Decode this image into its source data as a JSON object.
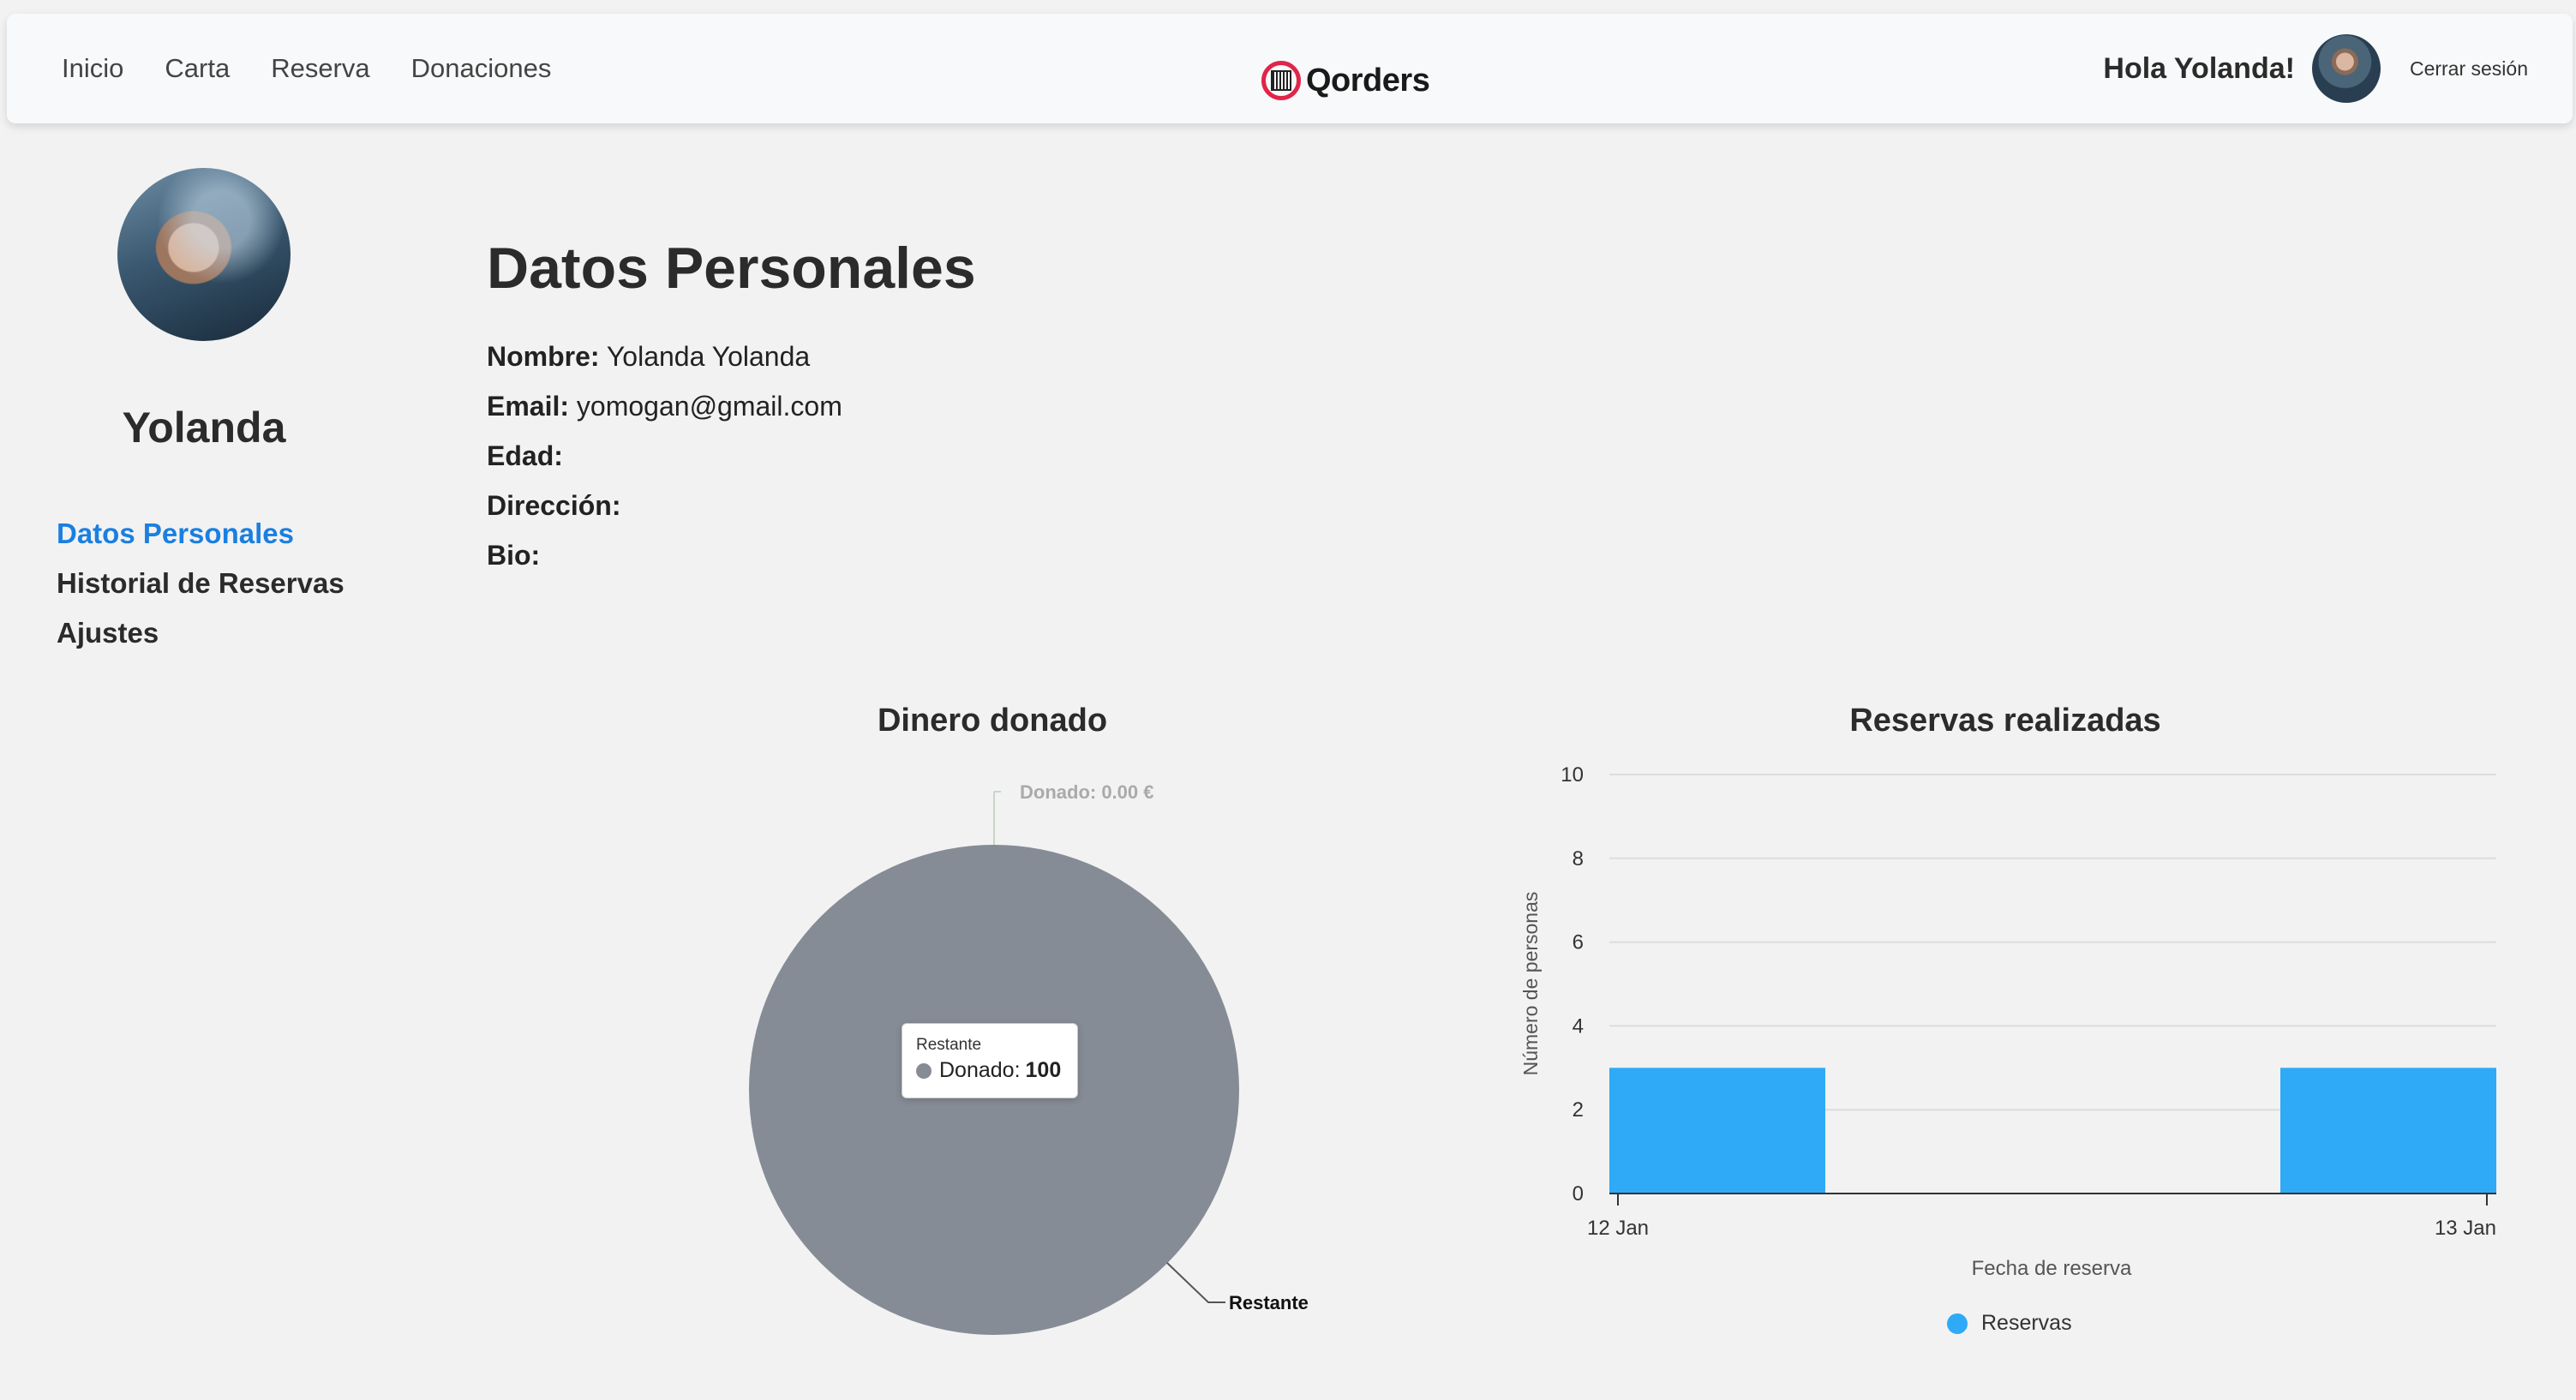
{
  "nav": {
    "links": [
      "Inicio",
      "Carta",
      "Reserva",
      "Donaciones"
    ],
    "brand": "Qorders",
    "greeting": "Hola Yolanda!",
    "logout": "Cerrar sesión"
  },
  "sidebar": {
    "name": "Yolanda",
    "items": [
      {
        "label": "Datos Personales",
        "active": true
      },
      {
        "label": "Historial de Reservas",
        "active": false
      },
      {
        "label": "Ajustes",
        "active": false
      }
    ]
  },
  "profile": {
    "title": "Datos Personales",
    "fields": [
      {
        "key": "Nombre:",
        "value": "Yolanda Yolanda"
      },
      {
        "key": "Email:",
        "value": "yomogan@gmail.com"
      },
      {
        "key": "Edad:",
        "value": ""
      },
      {
        "key": "Dirección:",
        "value": ""
      },
      {
        "key": "Bio:",
        "value": ""
      }
    ]
  },
  "colors": {
    "accent": "#1a7fe0",
    "pie_slice": "#868c95",
    "bar": "#2eaaf7",
    "brand_red": "#e0254a"
  },
  "chart_data": [
    {
      "type": "pie",
      "title": "Dinero donado",
      "slices": [
        {
          "name": "Donado: 0.00 €",
          "value": 0
        },
        {
          "name": "Restante",
          "value": 100
        }
      ],
      "tooltip": {
        "header": "Restante",
        "series": "Donado",
        "value": "100"
      }
    },
    {
      "type": "bar",
      "title": "Reservas realizadas",
      "xlabel": "Fecha de reserva",
      "ylabel": "Número de personas",
      "x_ticks": [
        "12 Jan",
        "13 Jan"
      ],
      "y_ticks": [
        "0",
        "2",
        "4",
        "6",
        "8",
        "10"
      ],
      "ylim": [
        0,
        10
      ],
      "grid": true,
      "legend": "bottom",
      "series": [
        {
          "name": "Reservas",
          "values": [
            3,
            3
          ]
        }
      ]
    }
  ]
}
